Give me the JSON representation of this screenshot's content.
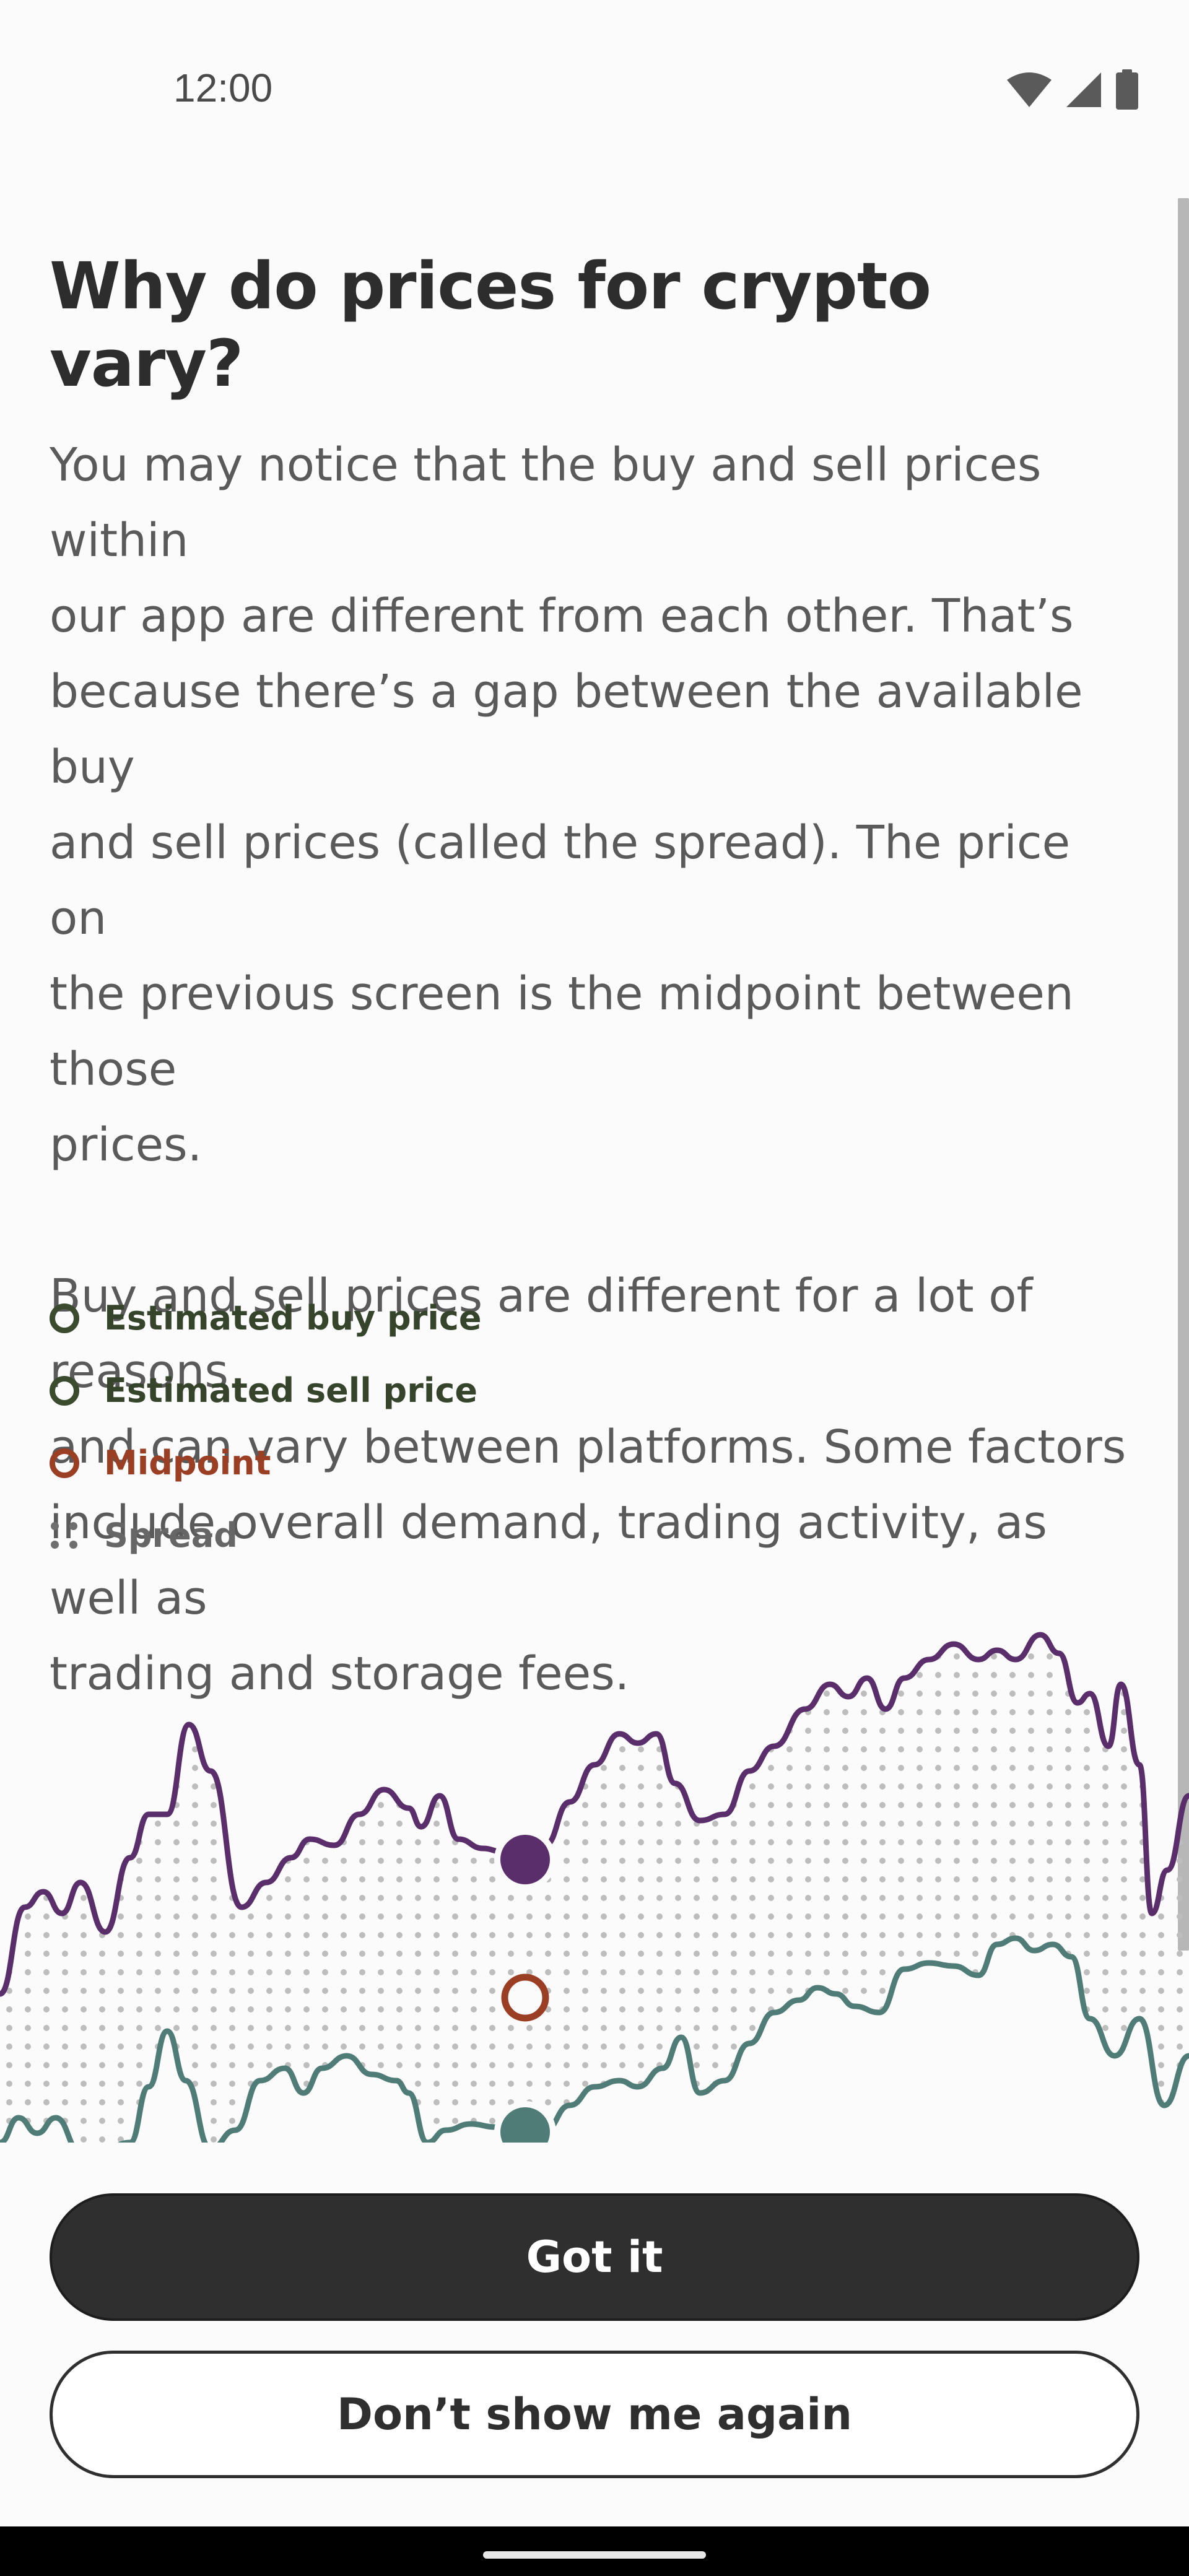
{
  "status_bar": {
    "time": "12:00",
    "icons": [
      "wifi-icon",
      "cellular-signal-icon",
      "battery-icon"
    ]
  },
  "page": {
    "title": "Why do prices for crypto vary?",
    "paragraph_1_lines": [
      "You may notice that the buy and sell prices within",
      "our app are different from each other. That’s",
      "because there’s a gap between the available buy",
      "and sell prices (called the spread). The price on",
      "the previous screen is the midpoint between those",
      "prices."
    ],
    "paragraph_2_lines": [
      "Buy and sell prices are different for a lot of reasons",
      "and can vary between platforms. Some factors",
      "include overall demand, trading activity, as well as",
      "trading and storage fees."
    ]
  },
  "legend": {
    "buy": "Estimated buy price",
    "sell": "Estimated sell price",
    "midpoint": "Midpoint",
    "spread": "Spread"
  },
  "colors": {
    "buy_line": "#5a2d6b",
    "sell_line": "#4f7c77",
    "midpoint": "#9a3f24",
    "legend_green": "#3b4b2e",
    "spread_dots": "#bdbdbd",
    "button_dark": "#2f2f2f"
  },
  "buttons": {
    "primary": "Got it",
    "secondary": "Don’t show me again"
  }
}
